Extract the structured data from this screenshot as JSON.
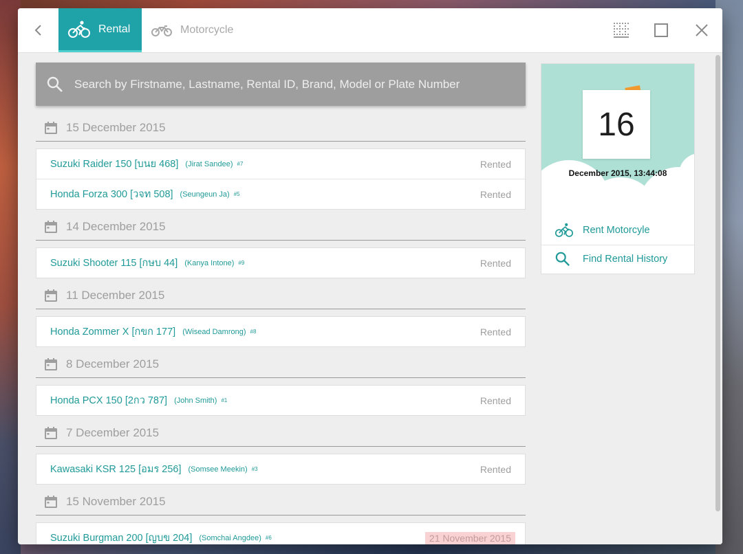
{
  "topbar": {
    "tabs": [
      {
        "label": "Rental",
        "active": true,
        "icon": "bicycle-icon"
      },
      {
        "label": "Motorcycle",
        "active": false,
        "icon": "motorcycle-icon"
      }
    ]
  },
  "search": {
    "placeholder": "Search by Firstname, Lastname, Rental ID, Brand, Model or Plate Number"
  },
  "rentals": [
    {
      "date": "15 December 2015",
      "items": [
        {
          "vehicle": "Suzuki Raider 150 [บนย 468]",
          "customer": "(Jirat Sandee)",
          "id": "#7",
          "status": "Rented"
        },
        {
          "vehicle": "Honda Forza 300 [วจท 508]",
          "customer": "(Seungeun Ja)",
          "id": "#5",
          "status": "Rented"
        }
      ]
    },
    {
      "date": "14 December 2015",
      "items": [
        {
          "vehicle": "Suzuki Shooter 115 [กษบ 44]",
          "customer": "(Kanya Intone)",
          "id": "#9",
          "status": "Rented"
        }
      ]
    },
    {
      "date": "11 December 2015",
      "items": [
        {
          "vehicle": "Honda Zommer X [กขก 177]",
          "customer": "(Wisead Damrong)",
          "id": "#8",
          "status": "Rented"
        }
      ]
    },
    {
      "date": "8 December 2015",
      "items": [
        {
          "vehicle": "Honda PCX 150 [2กว 787]",
          "customer": "(John Smith)",
          "id": "#1",
          "status": "Rented"
        }
      ]
    },
    {
      "date": "7 December 2015",
      "items": [
        {
          "vehicle": "Kawasaki KSR 125 [อมร 256]",
          "customer": "(Somsee Meekin)",
          "id": "#3",
          "status": "Rented"
        }
      ]
    },
    {
      "date": "15 November 2015",
      "items": [
        {
          "vehicle": "Suzuki Burgman 200 [ญบข 204]",
          "customer": "(Somchai Angdee)",
          "id": "#6",
          "status": "21 November 2015",
          "overdue": true
        }
      ]
    }
  ],
  "side": {
    "day": "16",
    "datetime": "December 2015, 13:44:08",
    "links": [
      {
        "label": "Rent Motorcyle",
        "icon": "bicycle-icon"
      },
      {
        "label": "Find Rental History",
        "icon": "search-icon"
      }
    ]
  },
  "colors": {
    "accent": "#1fa2a8",
    "link": "#1f9a98",
    "muted": "#9e9e9e",
    "overdue_bg": "#f9d3d3"
  }
}
